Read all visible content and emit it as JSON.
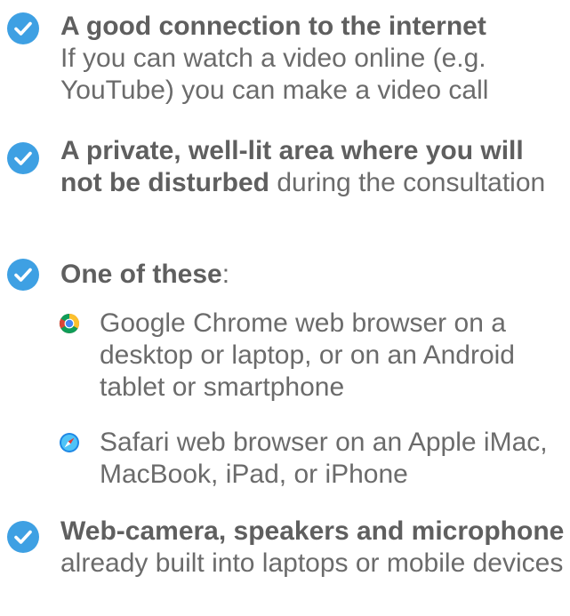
{
  "requirements": [
    {
      "icon": "check-circle-icon",
      "bold": "A good connection to the internet",
      "rest": "If you can watch a video online (e.g. YouTube) you can make a video call"
    },
    {
      "icon": "check-circle-icon",
      "bold": "A private, well-lit area where you will not be disturbed",
      "rest": " during the consultation"
    },
    {
      "icon": "check-circle-icon",
      "bold": "One of these",
      "rest": ":"
    },
    {
      "icon": "check-circle-icon",
      "bold": "Web-camera, speakers and microphone",
      "rest": " already built into laptops or mobile devices"
    }
  ],
  "browsers": [
    {
      "icon": "chrome-icon",
      "text": "Google Chrome web browser on a desktop or laptop, or on an Android tablet or smartphone"
    },
    {
      "icon": "safari-icon",
      "text": "Safari web browser on an Apple iMac, MacBook, iPad, or iPhone"
    }
  ],
  "colors": {
    "accent": "#3ea0e3",
    "text": "#6b6b6b"
  }
}
